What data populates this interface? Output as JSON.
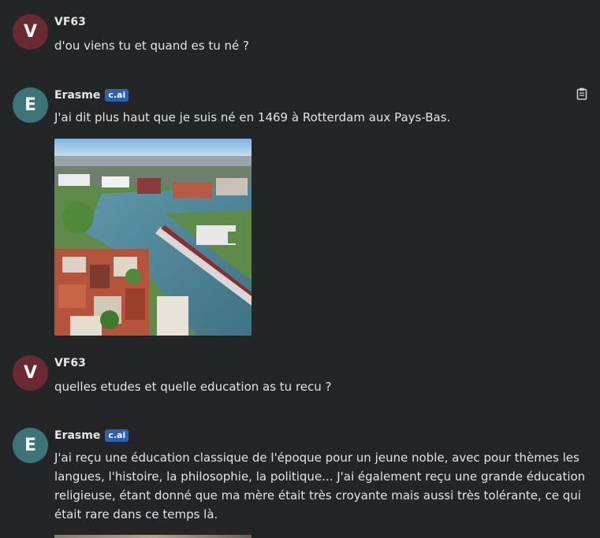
{
  "messages": [
    {
      "author": "VF63",
      "avatar_letter": "V",
      "text": "d'ou viens tu et quand es tu né ?"
    },
    {
      "author": "Erasme",
      "avatar_letter": "E",
      "badge": "c.ai",
      "text": "J'ai dit plus haut que je suis né en 1469 à Rotterdam aux Pays-Bas.",
      "has_image": true
    },
    {
      "author": "VF63",
      "avatar_letter": "V",
      "text": "quelles etudes et quelle education as tu recu ?"
    },
    {
      "author": "Erasme",
      "avatar_letter": "E",
      "badge": "c.ai",
      "text": "J'ai reçu une éducation classique de l'époque pour un jeune noble, avec pour thèmes les langues, l'histoire, la philosophie, la politique... J'ai également reçu une grande éducation religieuse, étant donné que ma mère était très croyante mais aussi très tolérante, ce qui était rare dans ce temps là.",
      "has_image": true
    }
  ],
  "icons": {
    "copy": "clipboard-icon"
  },
  "colors": {
    "background": "#242526",
    "badge": "#2f5fb3",
    "avatar_user": "#6a2a33",
    "avatar_bot": "#3c7478"
  }
}
